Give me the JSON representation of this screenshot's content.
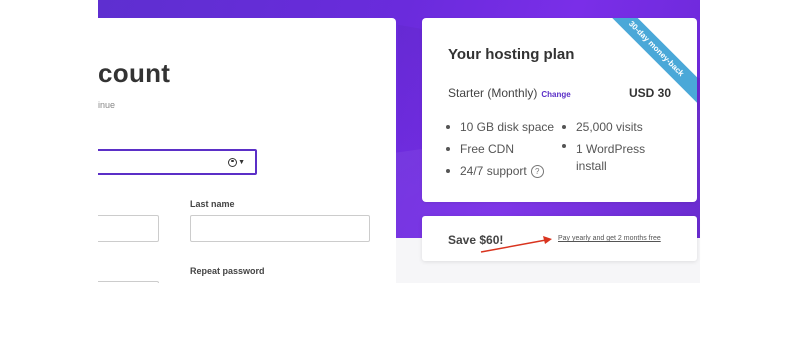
{
  "form": {
    "title": "count",
    "subtitle": "inue",
    "labels": {
      "last_name": "Last name",
      "repeat_password": "Repeat password"
    }
  },
  "plan": {
    "title": "Your hosting plan",
    "ribbon": "30-day money-back",
    "plan_name": "Starter (Monthly)",
    "change_label": "Change",
    "price": "USD 30",
    "features_left": [
      "10 GB disk space",
      "Free CDN",
      "24/7 support"
    ],
    "features_right": [
      "25,000 visits",
      "1 WordPress install"
    ],
    "help_symbol": "?"
  },
  "save": {
    "text": "Save $60!",
    "link": "Pay yearly and get 2 months free"
  },
  "colors": {
    "brand_purple": "#5b2fc7",
    "ribbon_blue": "#4aa8d8",
    "annotation_red": "#d9341f"
  }
}
